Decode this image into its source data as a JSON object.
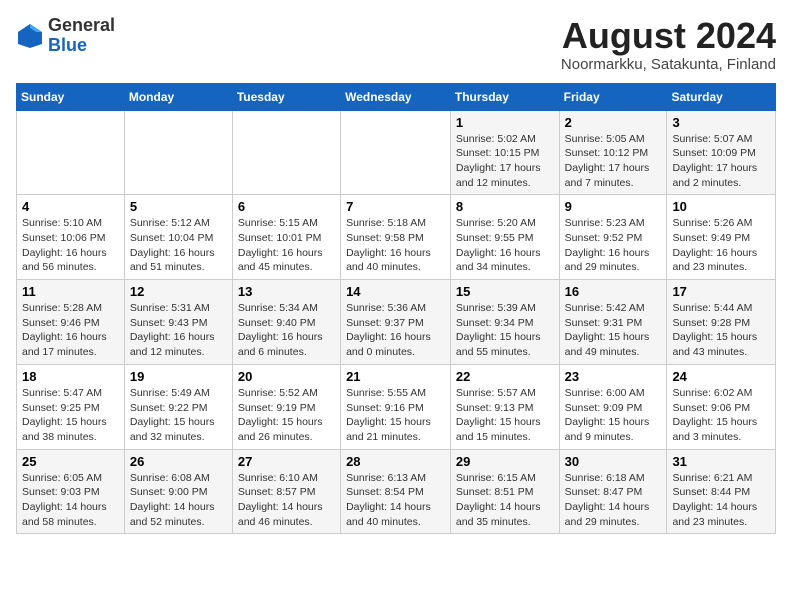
{
  "logo": {
    "general": "General",
    "blue": "Blue"
  },
  "header": {
    "month_year": "August 2024",
    "location": "Noormarkku, Satakunta, Finland"
  },
  "days_of_week": [
    "Sunday",
    "Monday",
    "Tuesday",
    "Wednesday",
    "Thursday",
    "Friday",
    "Saturday"
  ],
  "weeks": [
    [
      {
        "day": "",
        "info": ""
      },
      {
        "day": "",
        "info": ""
      },
      {
        "day": "",
        "info": ""
      },
      {
        "day": "",
        "info": ""
      },
      {
        "day": "1",
        "info": "Sunrise: 5:02 AM\nSunset: 10:15 PM\nDaylight: 17 hours\nand 12 minutes."
      },
      {
        "day": "2",
        "info": "Sunrise: 5:05 AM\nSunset: 10:12 PM\nDaylight: 17 hours\nand 7 minutes."
      },
      {
        "day": "3",
        "info": "Sunrise: 5:07 AM\nSunset: 10:09 PM\nDaylight: 17 hours\nand 2 minutes."
      }
    ],
    [
      {
        "day": "4",
        "info": "Sunrise: 5:10 AM\nSunset: 10:06 PM\nDaylight: 16 hours\nand 56 minutes."
      },
      {
        "day": "5",
        "info": "Sunrise: 5:12 AM\nSunset: 10:04 PM\nDaylight: 16 hours\nand 51 minutes."
      },
      {
        "day": "6",
        "info": "Sunrise: 5:15 AM\nSunset: 10:01 PM\nDaylight: 16 hours\nand 45 minutes."
      },
      {
        "day": "7",
        "info": "Sunrise: 5:18 AM\nSunset: 9:58 PM\nDaylight: 16 hours\nand 40 minutes."
      },
      {
        "day": "8",
        "info": "Sunrise: 5:20 AM\nSunset: 9:55 PM\nDaylight: 16 hours\nand 34 minutes."
      },
      {
        "day": "9",
        "info": "Sunrise: 5:23 AM\nSunset: 9:52 PM\nDaylight: 16 hours\nand 29 minutes."
      },
      {
        "day": "10",
        "info": "Sunrise: 5:26 AM\nSunset: 9:49 PM\nDaylight: 16 hours\nand 23 minutes."
      }
    ],
    [
      {
        "day": "11",
        "info": "Sunrise: 5:28 AM\nSunset: 9:46 PM\nDaylight: 16 hours\nand 17 minutes."
      },
      {
        "day": "12",
        "info": "Sunrise: 5:31 AM\nSunset: 9:43 PM\nDaylight: 16 hours\nand 12 minutes."
      },
      {
        "day": "13",
        "info": "Sunrise: 5:34 AM\nSunset: 9:40 PM\nDaylight: 16 hours\nand 6 minutes."
      },
      {
        "day": "14",
        "info": "Sunrise: 5:36 AM\nSunset: 9:37 PM\nDaylight: 16 hours\nand 0 minutes."
      },
      {
        "day": "15",
        "info": "Sunrise: 5:39 AM\nSunset: 9:34 PM\nDaylight: 15 hours\nand 55 minutes."
      },
      {
        "day": "16",
        "info": "Sunrise: 5:42 AM\nSunset: 9:31 PM\nDaylight: 15 hours\nand 49 minutes."
      },
      {
        "day": "17",
        "info": "Sunrise: 5:44 AM\nSunset: 9:28 PM\nDaylight: 15 hours\nand 43 minutes."
      }
    ],
    [
      {
        "day": "18",
        "info": "Sunrise: 5:47 AM\nSunset: 9:25 PM\nDaylight: 15 hours\nand 38 minutes."
      },
      {
        "day": "19",
        "info": "Sunrise: 5:49 AM\nSunset: 9:22 PM\nDaylight: 15 hours\nand 32 minutes."
      },
      {
        "day": "20",
        "info": "Sunrise: 5:52 AM\nSunset: 9:19 PM\nDaylight: 15 hours\nand 26 minutes."
      },
      {
        "day": "21",
        "info": "Sunrise: 5:55 AM\nSunset: 9:16 PM\nDaylight: 15 hours\nand 21 minutes."
      },
      {
        "day": "22",
        "info": "Sunrise: 5:57 AM\nSunset: 9:13 PM\nDaylight: 15 hours\nand 15 minutes."
      },
      {
        "day": "23",
        "info": "Sunrise: 6:00 AM\nSunset: 9:09 PM\nDaylight: 15 hours\nand 9 minutes."
      },
      {
        "day": "24",
        "info": "Sunrise: 6:02 AM\nSunset: 9:06 PM\nDaylight: 15 hours\nand 3 minutes."
      }
    ],
    [
      {
        "day": "25",
        "info": "Sunrise: 6:05 AM\nSunset: 9:03 PM\nDaylight: 14 hours\nand 58 minutes."
      },
      {
        "day": "26",
        "info": "Sunrise: 6:08 AM\nSunset: 9:00 PM\nDaylight: 14 hours\nand 52 minutes."
      },
      {
        "day": "27",
        "info": "Sunrise: 6:10 AM\nSunset: 8:57 PM\nDaylight: 14 hours\nand 46 minutes."
      },
      {
        "day": "28",
        "info": "Sunrise: 6:13 AM\nSunset: 8:54 PM\nDaylight: 14 hours\nand 40 minutes."
      },
      {
        "day": "29",
        "info": "Sunrise: 6:15 AM\nSunset: 8:51 PM\nDaylight: 14 hours\nand 35 minutes."
      },
      {
        "day": "30",
        "info": "Sunrise: 6:18 AM\nSunset: 8:47 PM\nDaylight: 14 hours\nand 29 minutes."
      },
      {
        "day": "31",
        "info": "Sunrise: 6:21 AM\nSunset: 8:44 PM\nDaylight: 14 hours\nand 23 minutes."
      }
    ]
  ]
}
